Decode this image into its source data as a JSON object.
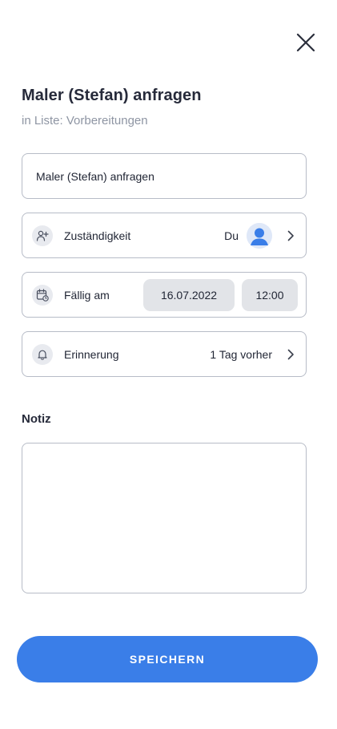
{
  "header": {
    "close_icon": "close-icon"
  },
  "task": {
    "title": "Maler (Stefan) anfragen",
    "subtitle": "in Liste: Vorbereitungen",
    "name_value": "Maler (Stefan) anfragen"
  },
  "assignment": {
    "icon": "add-person-icon",
    "label": "Zuständigkeit",
    "value": "Du"
  },
  "due": {
    "icon": "calendar-clock-icon",
    "label": "Fällig am",
    "date": "16.07.2022",
    "time": "12:00"
  },
  "reminder": {
    "icon": "bell-icon",
    "label": "Erinnerung",
    "value": "1 Tag vorher"
  },
  "notes": {
    "label": "Notiz",
    "value": ""
  },
  "actions": {
    "save_label": "SPEICHERN"
  },
  "colors": {
    "primary": "#3a7ee8",
    "border": "#b7bcc7",
    "pill_bg": "#e2e4e8",
    "muted_text": "#8e95a3"
  }
}
